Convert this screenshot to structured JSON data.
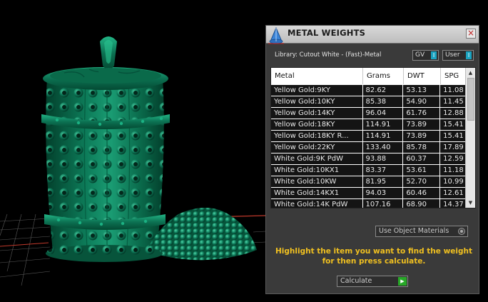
{
  "panel": {
    "title": "METAL WEIGHTS",
    "close_label": "×",
    "library_label": "Library: Cutout White - (Fast)-Metal",
    "toggle_gv": "GV",
    "toggle_user": "User",
    "toggle_knob": "I",
    "table": {
      "columns": [
        "Metal",
        "Grams",
        "DWT",
        "SPG"
      ],
      "rows": [
        [
          "Yellow Gold:9KY",
          "82.62",
          "53.13",
          "11.08"
        ],
        [
          "Yellow Gold:10KY",
          "85.38",
          "54.90",
          "11.45"
        ],
        [
          "Yellow Gold:14KY",
          "96.04",
          "61.76",
          "12.88"
        ],
        [
          "Yellow Gold:18KY",
          "114.91",
          "73.89",
          "15.41"
        ],
        [
          "Yellow Gold:18KY R...",
          "114.91",
          "73.89",
          "15.41"
        ],
        [
          "Yellow Gold:22KY",
          "133.40",
          "85.78",
          "17.89"
        ],
        [
          "White Gold:9K PdW",
          "93.88",
          "60.37",
          "12.59"
        ],
        [
          "White Gold:10KX1",
          "83.37",
          "53.61",
          "11.18"
        ],
        [
          "White Gold:10KW",
          "81.95",
          "52.70",
          "10.99"
        ],
        [
          "White Gold:14KX1",
          "94.03",
          "60.46",
          "12.61"
        ],
        [
          "White Gold:14K PdW",
          "107.16",
          "68.90",
          "14.37"
        ]
      ]
    },
    "use_object_materials": "Use Object Materials",
    "instructions": "Highlight the item you want to find the weight for then press calculate.",
    "calculate_label": "Calculate"
  },
  "colors": {
    "model_green": "#0e7a5a",
    "instruction_yellow": "#f0c020",
    "accent_cyan": "#1aa3c0",
    "go_green": "#28a828"
  },
  "icons": {
    "title_logo": "cone-logo-icon",
    "close": "close-icon",
    "scroll_up": "scroll-up-arrow-icon",
    "scroll_down": "scroll-down-arrow-icon",
    "calculate_go": "play-arrow-icon"
  }
}
